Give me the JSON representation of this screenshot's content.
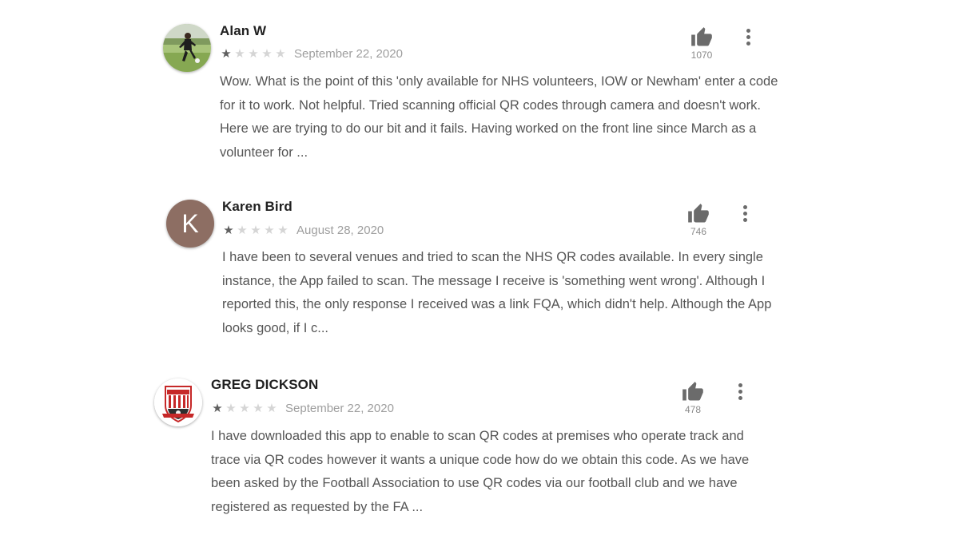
{
  "colors": {
    "star_on": "#5f5f5f",
    "star_off": "#d5d5d5",
    "avatar_k_bg": "#8d6e63",
    "icon": "#6b6b6b"
  },
  "reviews": [
    {
      "author": "Alan W",
      "rating": 1,
      "max_rating": 5,
      "date": "September 22, 2020",
      "helpful_count": "1070",
      "avatar": "photo-footballer",
      "text": "Wow. What is the point of this 'only available for NHS volunteers, IOW or Newham' enter a code for it to work. Not helpful. Tried scanning official QR codes through camera and doesn't work. Here we are trying to do our bit and it fails. Having worked on the front line since March as a volunteer for ..."
    },
    {
      "author": "Karen Bird",
      "rating": 1,
      "max_rating": 5,
      "date": "August 28, 2020",
      "helpful_count": "746",
      "avatar": "letter",
      "avatar_letter": "K",
      "text": "I have been to several venues and tried to scan the NHS QR codes available. In every single instance, the App failed to scan. The message I receive is 'something went wrong'. Although I reported this, the only response I received was a link FQA, which didn't help. Although the App looks good, if I c..."
    },
    {
      "author": "GREG DICKSON",
      "rating": 1,
      "max_rating": 5,
      "date": "September 22, 2020",
      "helpful_count": "478",
      "avatar": "football-club-crest",
      "text": "I have downloaded this app to enable to scan QR codes at premises who operate track and trace via QR codes however it wants a unique code how do we obtain this code. As we have been asked by the Football Association to use QR codes via our football club and we have registered as requested by the FA ..."
    }
  ]
}
